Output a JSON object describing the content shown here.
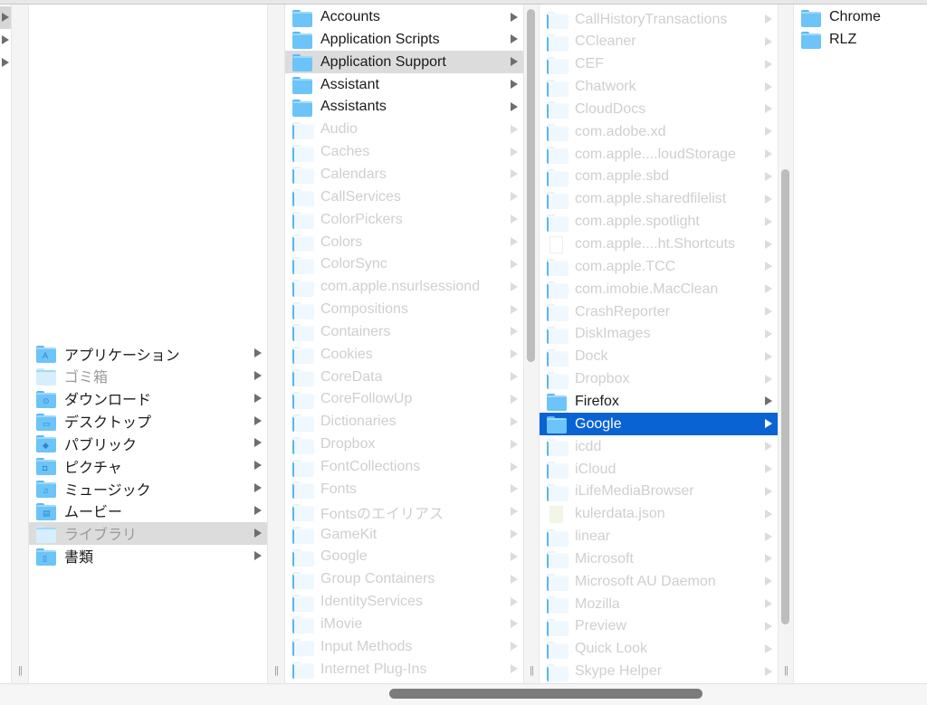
{
  "window": {
    "colors": {
      "selection": "#0a63d3",
      "inactive_selection": "#dcdcdc",
      "folder": "#6cc4f8"
    }
  },
  "column0": {
    "rows": [
      {
        "selected": true
      },
      {
        "selected": false
      },
      {
        "selected": false
      }
    ]
  },
  "column1": {
    "items": [
      {
        "label": "アプリケーション",
        "icon": "applications-folder-icon",
        "sym": "A"
      },
      {
        "label": "ゴミ箱",
        "icon": "trash-folder-icon",
        "state": "dimtext"
      },
      {
        "label": "ダウンロード",
        "icon": "downloads-folder-icon",
        "sym": "⊙"
      },
      {
        "label": "デスクトップ",
        "icon": "desktop-folder-icon",
        "sym": "▭"
      },
      {
        "label": "パブリック",
        "icon": "public-folder-icon",
        "sym": "◆"
      },
      {
        "label": "ピクチャ",
        "icon": "pictures-folder-icon",
        "sym": "◘"
      },
      {
        "label": "ミュージック",
        "icon": "music-folder-icon",
        "sym": "♫"
      },
      {
        "label": "ムービー",
        "icon": "movies-folder-icon",
        "sym": "▤"
      },
      {
        "label": "ライブラリ",
        "icon": "library-folder-icon",
        "state": "dimtext",
        "selected": "gray"
      },
      {
        "label": "書類",
        "icon": "documents-folder-icon",
        "sym": "▯"
      }
    ]
  },
  "column2": {
    "items": [
      {
        "label": "Accounts"
      },
      {
        "label": "Application Scripts"
      },
      {
        "label": "Application Support",
        "selected": "gray"
      },
      {
        "label": "Assistant"
      },
      {
        "label": "Assistants"
      },
      {
        "label": "Audio",
        "dim": true
      },
      {
        "label": "Caches",
        "dim": true
      },
      {
        "label": "Calendars",
        "dim": true
      },
      {
        "label": "CallServices",
        "dim": true
      },
      {
        "label": "ColorPickers",
        "dim": true
      },
      {
        "label": "Colors",
        "dim": true
      },
      {
        "label": "ColorSync",
        "dim": true
      },
      {
        "label": "com.apple.nsurlsessiond",
        "dim": true
      },
      {
        "label": "Compositions",
        "dim": true
      },
      {
        "label": "Containers",
        "dim": true
      },
      {
        "label": "Cookies",
        "dim": true
      },
      {
        "label": "CoreData",
        "dim": true
      },
      {
        "label": "CoreFollowUp",
        "dim": true
      },
      {
        "label": "Dictionaries",
        "dim": true
      },
      {
        "label": "Dropbox",
        "dim": true
      },
      {
        "label": "FontCollections",
        "dim": true
      },
      {
        "label": "Fonts",
        "dim": true
      },
      {
        "label": "Fontsのエイリアス",
        "dim": true
      },
      {
        "label": "GameKit",
        "dim": true
      },
      {
        "label": "Google",
        "dim": true
      },
      {
        "label": "Group Containers",
        "dim": true
      },
      {
        "label": "IdentityServices",
        "dim": true
      },
      {
        "label": "iMovie",
        "dim": true
      },
      {
        "label": "Input Methods",
        "dim": true
      },
      {
        "label": "Internet Plug-Ins",
        "dim": true
      }
    ]
  },
  "column3": {
    "items": [
      {
        "label": "CallHistoryTransactions",
        "dim": true
      },
      {
        "label": "CCleaner",
        "dim": true
      },
      {
        "label": "CEF",
        "dim": true
      },
      {
        "label": "Chatwork",
        "dim": true
      },
      {
        "label": "CloudDocs",
        "dim": true
      },
      {
        "label": "com.adobe.xd",
        "dim": true
      },
      {
        "label": "com.apple....loudStorage",
        "dim": true
      },
      {
        "label": "com.apple.sbd",
        "dim": true
      },
      {
        "label": "com.apple.sharedfilelist",
        "dim": true
      },
      {
        "label": "com.apple.spotlight",
        "dim": true
      },
      {
        "label": "com.apple....ht.Shortcuts",
        "dim": true,
        "kind": "file"
      },
      {
        "label": "com.apple.TCC",
        "dim": true
      },
      {
        "label": "com.imobie.MacClean",
        "dim": true
      },
      {
        "label": "CrashReporter",
        "dim": true
      },
      {
        "label": "DiskImages",
        "dim": true
      },
      {
        "label": "Dock",
        "dim": true
      },
      {
        "label": "Dropbox",
        "dim": true
      },
      {
        "label": "Firefox"
      },
      {
        "label": "Google",
        "selected": "blue"
      },
      {
        "label": "icdd",
        "dim": true
      },
      {
        "label": "iCloud",
        "dim": true
      },
      {
        "label": "iLifeMediaBrowser",
        "dim": true
      },
      {
        "label": "kulerdata.json",
        "dim": true,
        "kind": "json"
      },
      {
        "label": "linear",
        "dim": true
      },
      {
        "label": "Microsoft",
        "dim": true
      },
      {
        "label": "Microsoft AU Daemon",
        "dim": true
      },
      {
        "label": "Mozilla",
        "dim": true
      },
      {
        "label": "Preview",
        "dim": true
      },
      {
        "label": "Quick Look",
        "dim": true
      },
      {
        "label": "Skype Helper",
        "dim": true
      }
    ]
  },
  "column4": {
    "items": [
      {
        "label": "Chrome",
        "noarrow": true
      },
      {
        "label": "RLZ",
        "noarrow": true
      }
    ]
  },
  "grip": "||"
}
